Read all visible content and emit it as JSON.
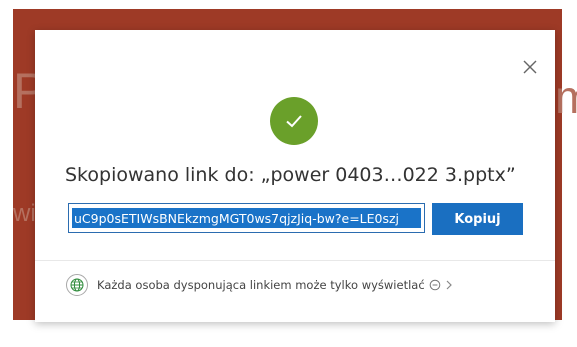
{
  "background": {
    "ghost_letter_left": "P",
    "ghost_letter_right": "m",
    "ghost_text_mid": "wi"
  },
  "dialog": {
    "close_icon": "close-icon",
    "status_icon": "checkmark-icon",
    "title": "Skopiowano link do: „power 0403…022 3.pptx”",
    "link_value": "uC9p0sETIWsBNEkzmgMGT0ws7qjzJiq-bw?e=LE0szj",
    "copy_button_label": "Kopiuj",
    "permission_text": "Każda osoba dysponująca linkiem może tylko wyświetlać",
    "permission_icon": "globe-icon",
    "accent_color": "#1a6fc1",
    "success_color": "#6aa02a"
  }
}
